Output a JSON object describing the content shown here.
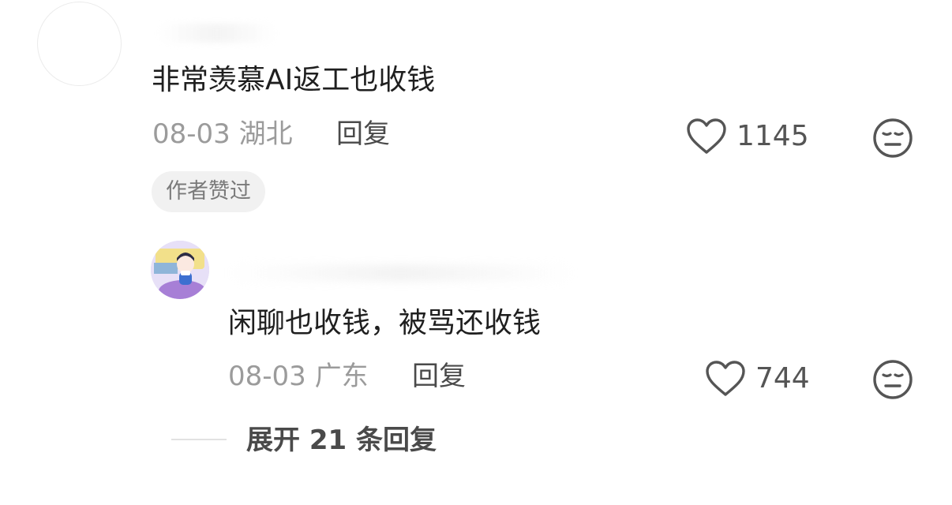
{
  "comment": {
    "text": "非常羡慕AI返工也收钱",
    "date": "08-03",
    "location": "湖北",
    "reply_label": "回复",
    "likes": "1145",
    "badge": "作者赞过"
  },
  "reply": {
    "text": "闲聊也收钱，被骂还收钱",
    "date": "08-03",
    "location": "广东",
    "reply_label": "回复",
    "likes": "744"
  },
  "expand": {
    "label": "展开 21 条回复"
  },
  "icons": {
    "like": "heart-outline-icon",
    "dislike": "meh-face-icon"
  },
  "colors": {
    "text_primary": "#1f1f1f",
    "text_secondary": "#9b9b9b",
    "badge_bg": "#f1f1f1"
  }
}
